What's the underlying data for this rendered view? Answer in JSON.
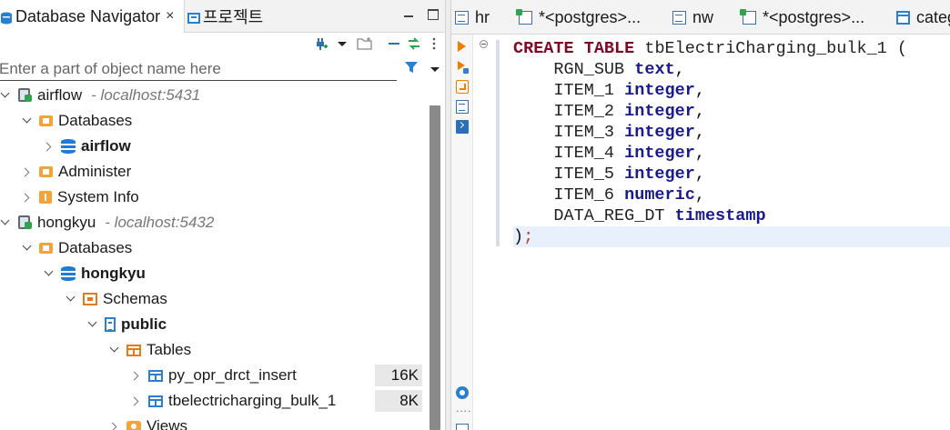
{
  "left_tabs": {
    "navigator_label": "Database Navigator",
    "close_glyph": "×",
    "project_label": "프로젝트"
  },
  "filter": {
    "placeholder": "Enter a part of object name here"
  },
  "tree": {
    "airflow_conn": {
      "name": "airflow",
      "host": "- localhost:5431"
    },
    "airflow_databases": "Databases",
    "airflow_db": "airflow",
    "airflow_administer": "Administer",
    "airflow_system_info": "System Info",
    "hongkyu_conn": {
      "name": "hongkyu",
      "host": "- localhost:5432"
    },
    "hongkyu_databases": "Databases",
    "hongkyu_db": "hongkyu",
    "schemas": "Schemas",
    "public": "public",
    "tables": "Tables",
    "table1": {
      "name": "py_opr_drct_insert",
      "size": "16K"
    },
    "table2": {
      "name": "tbelectricharging_bulk_1",
      "size": "8K"
    },
    "views": "Views"
  },
  "editor_tabs": [
    {
      "label": "hr",
      "icon": "sql-script-icon"
    },
    {
      "label": "*<postgres>...",
      "icon": "sql-console-icon"
    },
    {
      "label": "nw",
      "icon": "sql-script-icon"
    },
    {
      "label": "*<postgres>...",
      "icon": "sql-console-icon"
    },
    {
      "label": "categ",
      "icon": "table-icon"
    }
  ],
  "code": {
    "l1_kw": "CREATE TABLE",
    "l1_name": " tbElectriCharging_bulk_1 (",
    "l2_col": "    RGN_SUB ",
    "l2_type": "text",
    "l3_col": "    ITEM_1 ",
    "l3_type": "integer",
    "l4_col": "    ITEM_2 ",
    "l4_type": "integer",
    "l5_col": "    ITEM_3 ",
    "l5_type": "integer",
    "l6_col": "    ITEM_4 ",
    "l6_type": "integer",
    "l7_col": "    ITEM_5 ",
    "l7_type": "integer",
    "l8_col": "    ITEM_6 ",
    "l8_type": "numeric",
    "l9_col": "    DATA_REG_DT ",
    "l9_type": "timestamp",
    "l10_close": ")",
    "l10_semi": ";",
    "comma": ","
  },
  "colors": {
    "keyword": "#7f0a25",
    "type": "#1a1a8f",
    "accent_blue": "#2a7fd0",
    "accent_orange": "#f07c00"
  }
}
